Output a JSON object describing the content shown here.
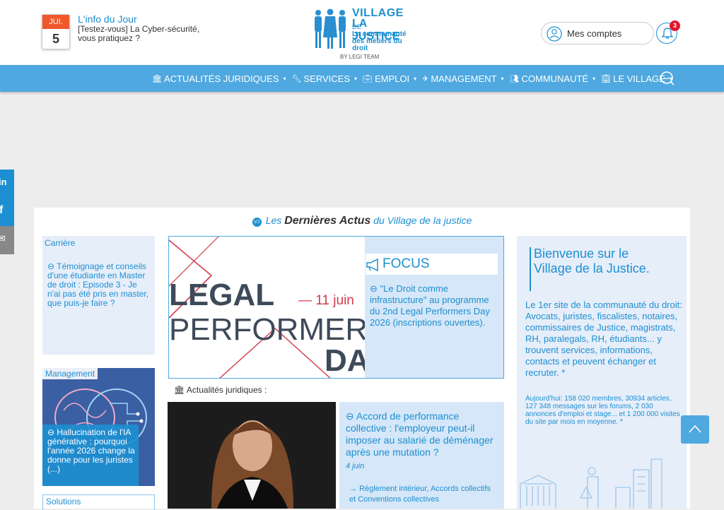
{
  "header": {
    "calendar": {
      "month": "JUI.",
      "day": "5"
    },
    "info_title": "L'info du Jour",
    "info_text": "[Testez-vous] La Cyber-sécurité, vous pratiquez ?",
    "logo": {
      "line1": "VILLAGE",
      "line1_small": "DE",
      "line2": "LA JUSTICE",
      "tagline": "La communauté des métiers du droit",
      "byline": "BY LEGI TEAM"
    },
    "accounts_label": "Mes comptes",
    "notifications_count": "3"
  },
  "nav": {
    "items": [
      {
        "label": "ACTUALITÉS JURIDIQUES",
        "icon": "bank-icon"
      },
      {
        "label": "SERVICES",
        "icon": "wrench-icon"
      },
      {
        "label": "EMPLOI",
        "icon": "briefcase-icon"
      },
      {
        "label": "MANAGEMENT",
        "icon": "rocket-icon"
      },
      {
        "label": "COMMUNAUTÉ",
        "icon": "users-icon"
      },
      {
        "label": "LE VILLAGE",
        "icon": "building-icon"
      }
    ],
    "caret": "▾"
  },
  "social": {
    "linkedin": "in",
    "facebook": "f",
    "email": "✉"
  },
  "main": {
    "heading_pre": "Les",
    "heading_bold": "Dernières Actus",
    "heading_post": "du Village de la justice",
    "vj": "VJ",
    "carriere": {
      "category": "Carrière",
      "text": "Témoignage et conseils d'une étudiante en Master de droit : Episode 3 - Je n'ai pas été pris en master, que puis-je faire ?"
    },
    "management": {
      "category": "Management",
      "text": "Hallucination de l'IA générative : pourquoi l'année 2026 change la donne pour les juristes (...)"
    },
    "solutions": {
      "category": "Solutions"
    },
    "hero": {
      "line1": "LEGAL",
      "date": "— 11 juin",
      "line2": "PERFORMERS",
      "line3": "DAY",
      "focus_title": "FOCUS",
      "focus_text": "\"Le Droit comme infrastructure\" au programme du 2nd Legal Performers Day 2026 (inscriptions ouvertes)."
    },
    "actualites_label": "Actualités juridiques :",
    "article": {
      "title": "Accord de performance collective : l'employeur peut-il imposer au salarié de déménager après une mutation ?",
      "date": "4 juin",
      "category": "Règlement intérieur, Accords collectifs et Conventions collectives"
    },
    "welcome": {
      "title": "Bienvenue sur le Village de la Justice.",
      "text": "Le 1er site de la communauté du droit: Avocats, juristes, fiscalistes, notaires, commissaires de Justice, magistrats, RH, paralegals, RH, étudiants... y trouvent services, informations, contacts et peuvent échanger et recruter. *",
      "stats": "Aujourd'hui: 158 020 membres, 30934 articles, 127 348 messages sur les forums, 2 030 annonces d'emploi et stage... et 1 200 000 visites du site par mois en moyenne. *"
    }
  },
  "colors": {
    "brand": "#1d8fd0",
    "nav": "#4fa8df",
    "accent": "#f0572a",
    "card": "#e6eefa"
  }
}
